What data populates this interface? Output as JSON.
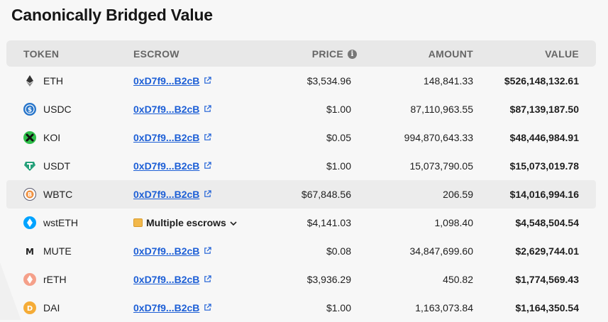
{
  "title": "Canonically Bridged Value",
  "headers": {
    "token": "TOKEN",
    "escrow": "ESCROW",
    "price": "PRICE",
    "amount": "AMOUNT",
    "value": "VALUE"
  },
  "rows": [
    {
      "token": "ETH",
      "icon": "eth-icon",
      "color": "#ffffff",
      "escrow": "0xD7f9...B2cB",
      "price": "$3,534.96",
      "amount": "148,841.33",
      "value": "$526,148,132.61"
    },
    {
      "token": "USDC",
      "icon": "usdc-icon",
      "color": "#2775ca",
      "escrow": "0xD7f9...B2cB",
      "price": "$1.00",
      "amount": "87,110,963.55",
      "value": "$87,139,187.50"
    },
    {
      "token": "KOI",
      "icon": "koi-icon",
      "color": "#2fbf4a",
      "escrow": "0xD7f9...B2cB",
      "price": "$0.05",
      "amount": "994,870,643.33",
      "value": "$48,446,984.91"
    },
    {
      "token": "USDT",
      "icon": "usdt-icon",
      "color": "#26a17b",
      "escrow": "0xD7f9...B2cB",
      "price": "$1.00",
      "amount": "15,073,790.05",
      "value": "$15,073,019.78"
    },
    {
      "token": "WBTC",
      "icon": "wbtc-icon",
      "color": "#f09242",
      "escrow": "0xD7f9...B2cB",
      "price": "$67,848.56",
      "amount": "206.59",
      "value": "$14,016,994.16"
    },
    {
      "token": "wstETH",
      "icon": "wsteth-icon",
      "color": "#00a3ff",
      "escrow": "Multiple escrows",
      "price": "$4,141.03",
      "amount": "1,098.40",
      "value": "$4,548,504.54"
    },
    {
      "token": "MUTE",
      "icon": "mute-icon",
      "color": "#ffffff",
      "escrow": "0xD7f9...B2cB",
      "price": "$0.08",
      "amount": "34,847,699.60",
      "value": "$2,629,744.01"
    },
    {
      "token": "rETH",
      "icon": "reth-icon",
      "color": "#f5a08a",
      "escrow": "0xD7f9...B2cB",
      "price": "$3,936.29",
      "amount": "450.82",
      "value": "$1,774,569.43"
    },
    {
      "token": "DAI",
      "icon": "dai-icon",
      "color": "#f5ac37",
      "escrow": "0xD7f9...B2cB",
      "price": "$1.00",
      "amount": "1,163,073.84",
      "value": "$1,164,350.54"
    }
  ]
}
